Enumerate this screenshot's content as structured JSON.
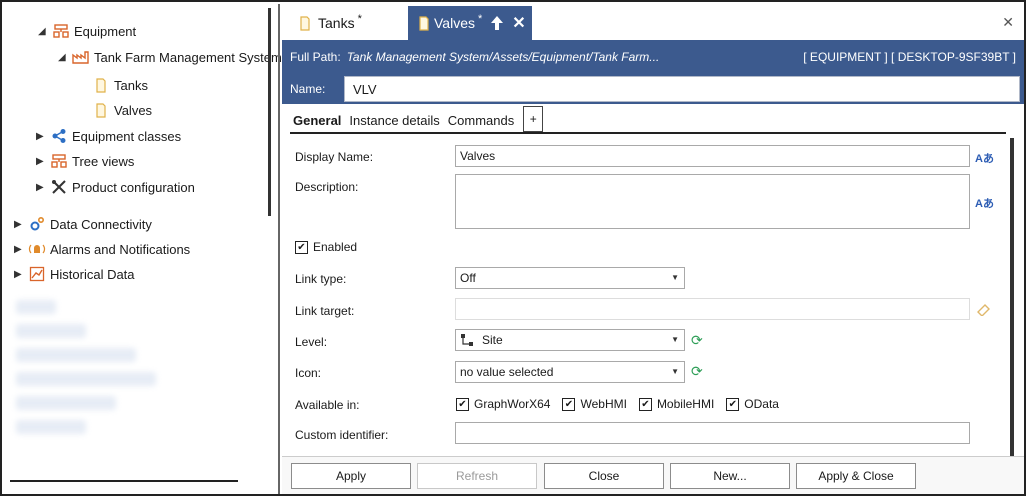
{
  "tree": {
    "items": [
      {
        "label": "Equipment"
      },
      {
        "label": "Tank Farm Management System"
      },
      {
        "label": "Tanks"
      },
      {
        "label": "Valves"
      },
      {
        "label": "Equipment classes"
      },
      {
        "label": "Tree views"
      },
      {
        "label": "Product configuration"
      },
      {
        "label": "Data Connectivity"
      },
      {
        "label": "Alarms and Notifications"
      },
      {
        "label": "Historical Data"
      }
    ]
  },
  "tabs": [
    {
      "label": "Tanks",
      "modified": "*"
    },
    {
      "label": "Valves",
      "modified": "*"
    }
  ],
  "header": {
    "full_path_label": "Full Path:",
    "full_path_value": "Tank Management System/Assets/Equipment/Tank Farm...",
    "context": "[ EQUIPMENT ] [ DESKTOP-9SF39BT ]",
    "name_label": "Name:",
    "name_value": "VLV"
  },
  "subtabs": [
    "General",
    "Instance details",
    "Commands"
  ],
  "subtab_add": "+",
  "form": {
    "display_name_label": "Display Name:",
    "display_name_value": "Valves",
    "description_label": "Description:",
    "enabled_label": "Enabled",
    "link_type_label": "Link type:",
    "link_type_value": "Off",
    "link_target_label": "Link target:",
    "level_label": "Level:",
    "level_value": "Site",
    "icon_label": "Icon:",
    "icon_value": "no value selected",
    "available_in_label": "Available in:",
    "available_in": [
      "GraphWorX64",
      "WebHMI",
      "MobileHMI",
      "OData"
    ],
    "custom_identifier_label": "Custom identifier:",
    "translate_glyph": "Aあ"
  },
  "buttons": {
    "apply": "Apply",
    "refresh": "Refresh",
    "close": "Close",
    "new": "New...",
    "apply_close": "Apply & Close"
  },
  "colors": {
    "accent": "#3c5a8e",
    "refresh_icon": "#2e9e57",
    "translate_icon": "#2d5db4"
  }
}
